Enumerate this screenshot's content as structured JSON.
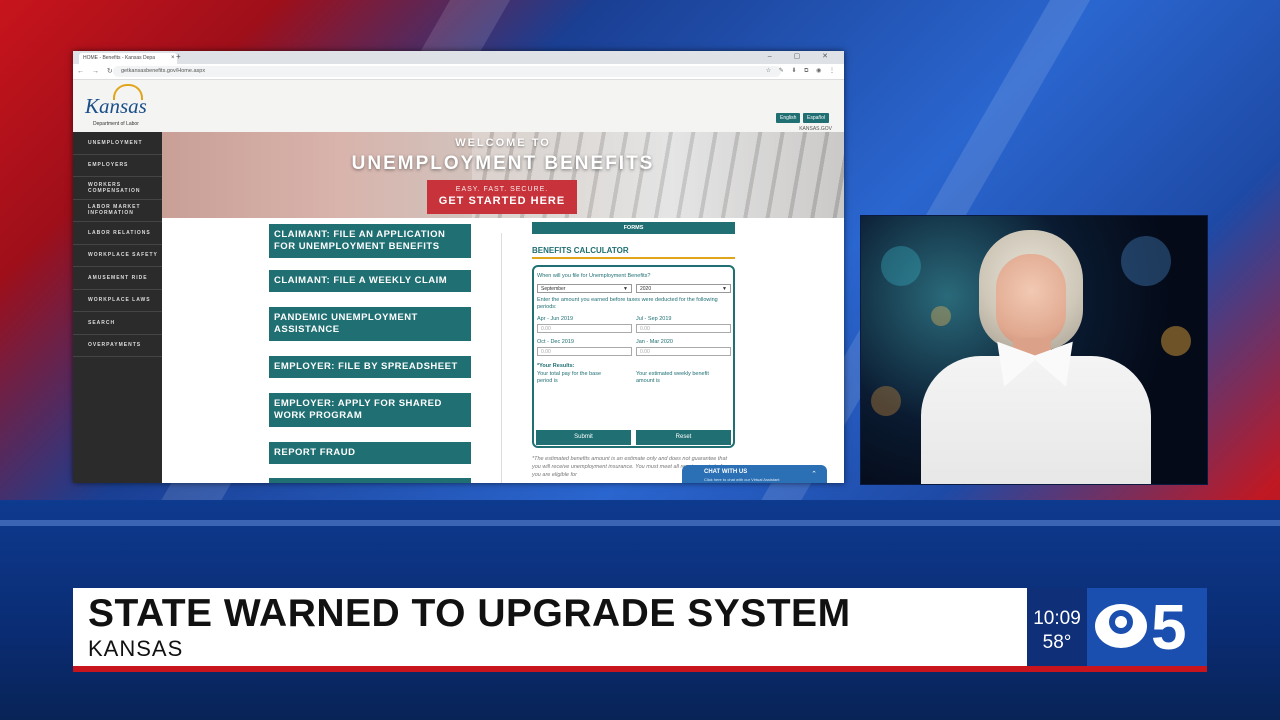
{
  "browser": {
    "tab_title": "HOME - Benefits - Kansas Depa",
    "tab_close": "×",
    "new_tab": "+",
    "window_controls": "– ▢ ✕",
    "nav_arrows": "← → ↻",
    "url": "getkansasbenefits.gov/Home.aspx",
    "ext_icons": "☆ ✎ ⬇ ⧉ ◉ ⋮"
  },
  "site": {
    "logo_text": "Kansas",
    "logo_sub": "Department of Labor",
    "lang_english": "English",
    "lang_spanish": "Español",
    "kansas_gov": "KANSAS.GOV",
    "social_icons": [
      "f",
      "t",
      "▶",
      "◎"
    ],
    "sidebar": [
      "UNEMPLOYMENT",
      "EMPLOYERS",
      "WORKERS COMPENSATION",
      "LABOR MARKET INFORMATION",
      "LABOR RELATIONS",
      "WORKPLACE SAFETY",
      "AMUSEMENT RIDE",
      "WORKPLACE LAWS",
      "SEARCH",
      "OVERPAYMENTS"
    ],
    "hero": {
      "welcome": "WELCOME TO",
      "title": "UNEMPLOYMENT BENEFITS",
      "cta_small": "EASY. FAST. SECURE.",
      "cta_big": "GET STARTED HERE"
    },
    "buttons": [
      "CLAIMANT: FILE AN APPLICATION FOR UNEMPLOYMENT BENEFITS",
      "CLAIMANT: FILE A WEEKLY CLAIM",
      "PANDEMIC UNEMPLOYMENT ASSISTANCE",
      "EMPLOYER: FILE BY SPREADSHEET",
      "EMPLOYER: APPLY FOR SHARED WORK PROGRAM",
      "REPORT FRAUD",
      ""
    ],
    "forms_label": "FORMS",
    "calculator": {
      "title": "BENEFITS CALCULATOR",
      "question": "When will you file for Unemployment Benefits?",
      "month_value": "September",
      "year_value": "2020",
      "instruction": "Enter the amount you earned before taxes were deducted for the following periods:",
      "p1_label": "Apr - Jun 2019",
      "p2_label": "Jul - Sep 2019",
      "p3_label": "Oct - Dec 2019",
      "p4_label": "Jan - Mar 2020",
      "placeholder": "0.00",
      "results_label": "*Your Results:",
      "result_base": "Your total pay for the base period is",
      "result_weekly": "Your estimated weekly benefit amount is",
      "submit": "Submit",
      "reset": "Reset"
    },
    "disclaimer": "*The estimated benefits amount is an estimate only and does not guarantee that you will receive unemployment insurance. You must meet all requirements before you are eligible for",
    "chat_title": "CHAT WITH US",
    "chat_sub": "Click here to chat with our Virtual Assistant",
    "chat_chevron": "⌃"
  },
  "lower_third": {
    "headline": "STATE WARNED TO UPGRADE SYSTEM",
    "subline": "KANSAS",
    "time": "10:09",
    "temp": "58°",
    "channel_number": "5"
  },
  "colors": {
    "teal": "#1f6f73",
    "cta_red": "#c8323a",
    "station_blue": "#1a4fb0",
    "accent_red": "#c8141c"
  }
}
